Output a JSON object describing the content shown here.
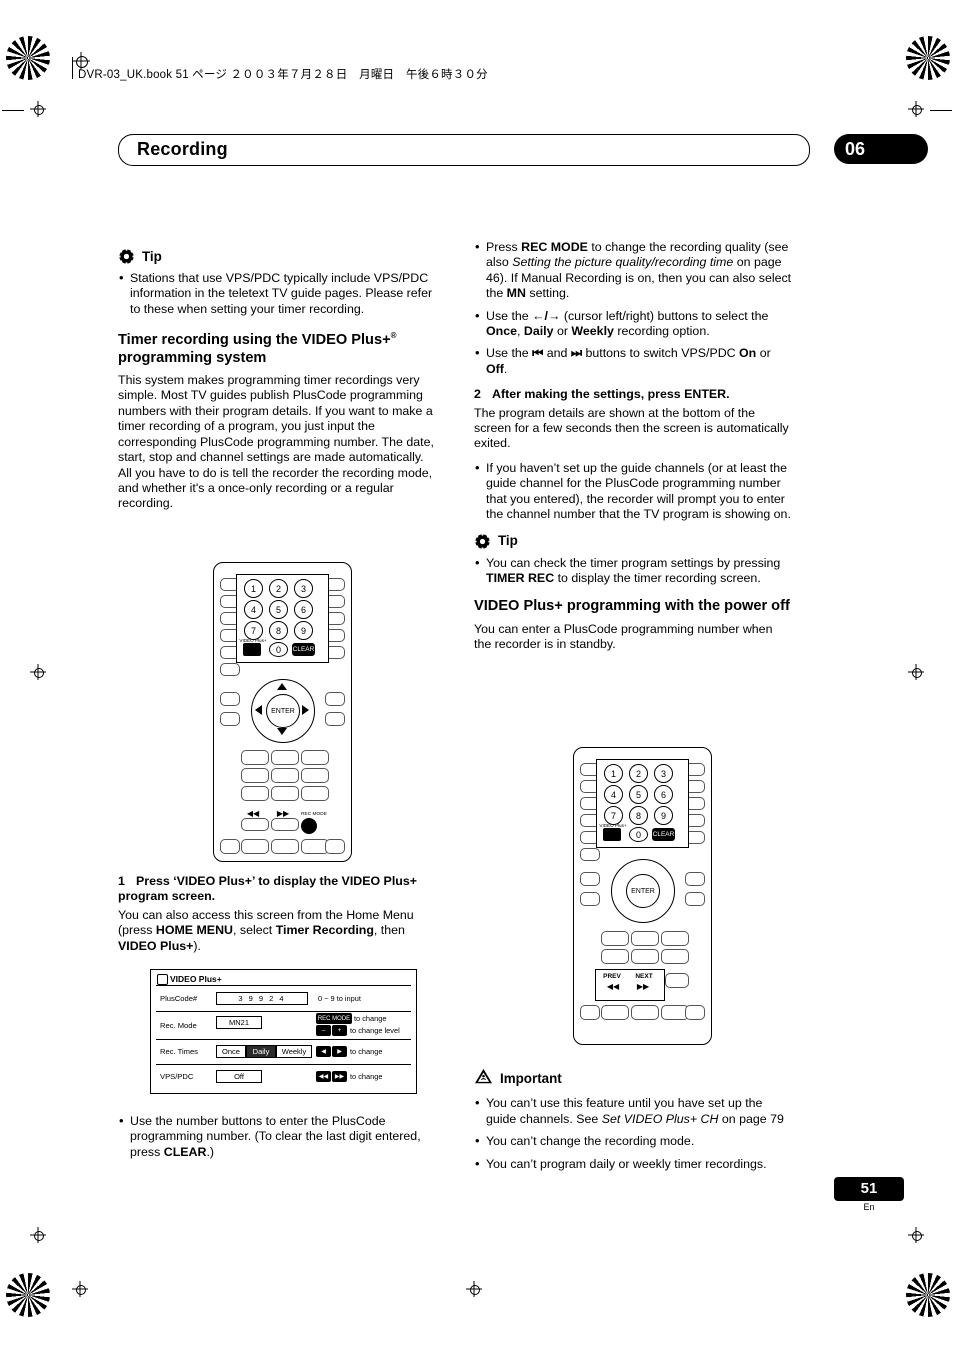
{
  "header": {
    "filename_line": "DVR-03_UK.book  51 ページ  ２００３年７月２８日　月曜日　午後６時３０分",
    "chapter_title": "Recording",
    "chapter_number": "06"
  },
  "left_column": {
    "tip_label": "Tip",
    "tip_bullets": [
      "Stations that use VPS/PDC typically include VPS/PDC information in the teletext TV guide pages. Please refer to these when setting your timer recording."
    ],
    "section_heading_line1": "Timer recording using the VIDEO Plus+",
    "section_heading_sup": "®",
    "section_heading_line2": "programming system",
    "section_body": "This system makes programming timer recordings very simple. Most TV guides publish PlusCode programming numbers with their program details. If you want to make a timer recording of a program, you just input the corresponding PlusCode programming number. The date, start, stop and channel settings are made automatically. All you have to do is tell the recorder the recording mode, and whether it's a once-only recording or a regular recording.",
    "step1_number": "1",
    "step1_text": "Press ‘VIDEO Plus+’ to display the VIDEO Plus+ program screen.",
    "step1_body_a": "You can also access this screen from the Home Menu (press ",
    "step1_body_b": "HOME MENU",
    "step1_body_c": ", select ",
    "step1_body_d": "Timer Recording",
    "step1_body_e": ", then ",
    "step1_body_f": "VIDEO Plus+",
    "step1_body_g": ").",
    "after_screen_bullet_a": "Use the number buttons to enter the PlusCode programming number. (To clear the last digit entered, press ",
    "after_screen_bullet_b": "CLEAR",
    "after_screen_bullet_c": ".)"
  },
  "video_plus_screen": {
    "title": "VIDEO Plus+",
    "rows": [
      {
        "label": "PlusCode#",
        "value": "3 9 9 2 4",
        "note": "0 ~ 9  to input"
      },
      {
        "label": "Rec. Mode",
        "value": "MN21",
        "key": "REC MODE",
        "note": "to change",
        "note2": "to change level",
        "plus": "+",
        "minus": "–"
      },
      {
        "label": "Rec. Times",
        "options": [
          "Once",
          "Daily",
          "Weekly"
        ],
        "selected": "Daily",
        "note": "to change"
      },
      {
        "label": "VPS/PDC",
        "value": "Off",
        "note": "to change"
      }
    ]
  },
  "remote_top": {
    "num_keys": [
      "1",
      "2",
      "3",
      "4",
      "5",
      "6",
      "7",
      "8",
      "9",
      "0"
    ],
    "clear_label": "CLEAR",
    "videoplus_label": "VIDEO Plus+",
    "enter_label": "ENTER",
    "rec_mode_label": "REC MODE",
    "transport_left": "◀◀",
    "transport_right": "▶▶"
  },
  "remote_bottom": {
    "num_keys": [
      "1",
      "2",
      "3",
      "4",
      "5",
      "6",
      "7",
      "8",
      "9",
      "0"
    ],
    "clear_label": "CLEAR",
    "videoplus_label": "VIDEO Plus+",
    "enter_label": "ENTER",
    "prev_label": "PREV",
    "next_label": "NEXT",
    "prev_glyph": "◀◀",
    "next_glyph": "▶▶"
  },
  "right_column": {
    "bullets_top": [
      {
        "a": "Press ",
        "b": "REC MODE",
        "c": " to change the recording quality (see also ",
        "i": "Setting the picture quality/recording time",
        "d": " on page 46). If Manual Recording is on, then you can also select the ",
        "e": "MN",
        "f": " setting."
      },
      {
        "a": "Use the ",
        "glyphs": "←/→",
        "c": " (cursor left/right) buttons to select the ",
        "b1": "Once",
        "sep1": ", ",
        "b2": "Daily",
        "sep2": " or ",
        "b3": "Weekly",
        "d": " recording option."
      },
      {
        "a": "Use the ",
        "g1": "⏮",
        "mid": " and ",
        "g2": "⏭",
        "c": " buttons to switch VPS/PDC ",
        "b1": "On",
        "d": " or ",
        "b2": "Off",
        "e": "."
      }
    ],
    "step2_number": "2",
    "step2_text": "After making the settings, press ENTER.",
    "step2_body": "The program details are shown at the bottom of the screen for a few seconds then the screen is automatically exited.",
    "step2_bullets": [
      "If you haven’t set up the guide channels (or at least the guide channel for the PlusCode programming number that you entered), the recorder will prompt you to enter the channel number that the TV program is showing on."
    ],
    "tip_label": "Tip",
    "tip_bullet_a": "You can check the timer program settings by pressing ",
    "tip_bullet_b": "TIMER REC",
    "tip_bullet_c": " to display the timer recording screen.",
    "section_heading": "VIDEO Plus+ programming with the power off",
    "section_body": "You can enter a PlusCode programming number when the recorder is in standby.",
    "important_label": "Important",
    "important_bullets": [
      {
        "a": "You can’t use this feature until you have set up the guide channels. See ",
        "i": "Set VIDEO Plus+ CH",
        "b": " on page 79"
      },
      {
        "a": "You can’t change the recording mode."
      },
      {
        "a": "You can’t program daily or weekly timer recordings."
      }
    ]
  },
  "footer": {
    "page_number": "51",
    "language": "En"
  }
}
